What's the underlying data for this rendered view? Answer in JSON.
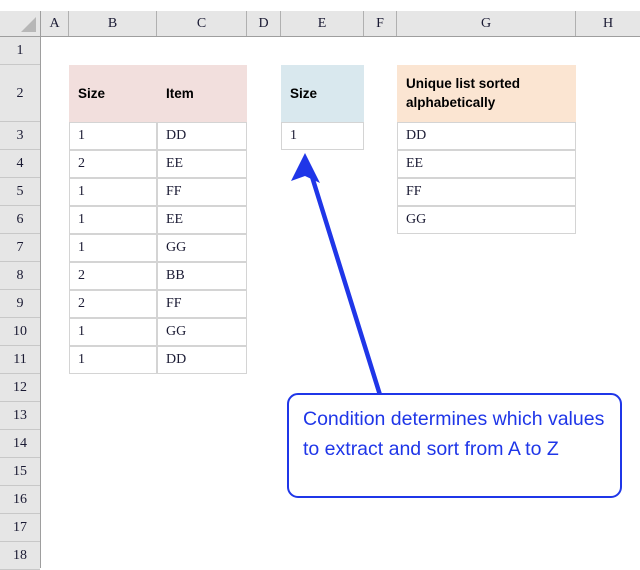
{
  "app": {
    "type": "spreadsheet",
    "select_all_corner": "select-all-triangle"
  },
  "grid": {
    "column_headers": [
      "A",
      "B",
      "C",
      "D",
      "E",
      "F",
      "G",
      "H"
    ],
    "row_headers": [
      "1",
      "2",
      "3",
      "4",
      "5",
      "6",
      "7",
      "8",
      "9",
      "10",
      "11",
      "12",
      "13",
      "14",
      "15",
      "16",
      "17",
      "18"
    ]
  },
  "source_table": {
    "headers": [
      "Size",
      "Item"
    ],
    "header_fill": "#f2dfdd",
    "rows": [
      {
        "size": "1",
        "item": "DD"
      },
      {
        "size": "2",
        "item": "EE"
      },
      {
        "size": "1",
        "item": "FF"
      },
      {
        "size": "1",
        "item": "EE"
      },
      {
        "size": "1",
        "item": "GG"
      },
      {
        "size": "2",
        "item": "BB"
      },
      {
        "size": "2",
        "item": "FF"
      },
      {
        "size": "1",
        "item": "GG"
      },
      {
        "size": "1",
        "item": "DD"
      }
    ]
  },
  "condition_table": {
    "header": "Size",
    "header_fill": "#d9e8ee",
    "value": "1"
  },
  "result_table": {
    "header": "Unique list sorted alphabetically",
    "header_fill": "#fbe5d2",
    "values": [
      "DD",
      "EE",
      "FF",
      "GG"
    ]
  },
  "callout": {
    "text": "Condition determines which values to extract and sort from A to Z",
    "color": "#1f36e8"
  }
}
